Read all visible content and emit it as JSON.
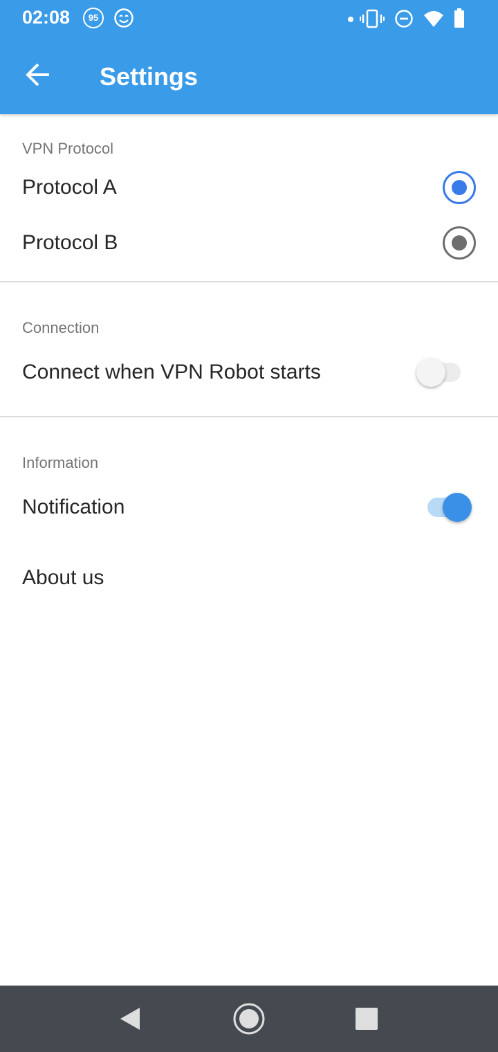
{
  "status_bar": {
    "time": "02:08",
    "badge_number": "95",
    "icons": [
      "smiley-icon",
      "dot-icon",
      "vibrate-icon",
      "do-not-disturb-icon",
      "wifi-icon",
      "battery-icon"
    ]
  },
  "app_bar": {
    "title": "Settings",
    "back_icon": "arrow-left-icon",
    "color": "#3a9be8"
  },
  "sections": {
    "vpn_protocol": {
      "header": "VPN Protocol",
      "options": [
        {
          "label": "Protocol A",
          "selected": true
        },
        {
          "label": "Protocol B",
          "selected": false
        }
      ]
    },
    "connection": {
      "header": "Connection",
      "connect_on_start": {
        "label": "Connect when VPN Robot starts",
        "enabled": false
      }
    },
    "information": {
      "header": "Information",
      "notification": {
        "label": "Notification",
        "enabled": true
      },
      "about": {
        "label": "About us"
      }
    }
  },
  "colors": {
    "accent": "#3a7bea",
    "switch_on": "#3a90e6",
    "nav_bar": "#454a51"
  },
  "nav_bar": {
    "buttons": [
      "back-triangle-icon",
      "home-circle-icon",
      "recents-square-icon"
    ]
  }
}
